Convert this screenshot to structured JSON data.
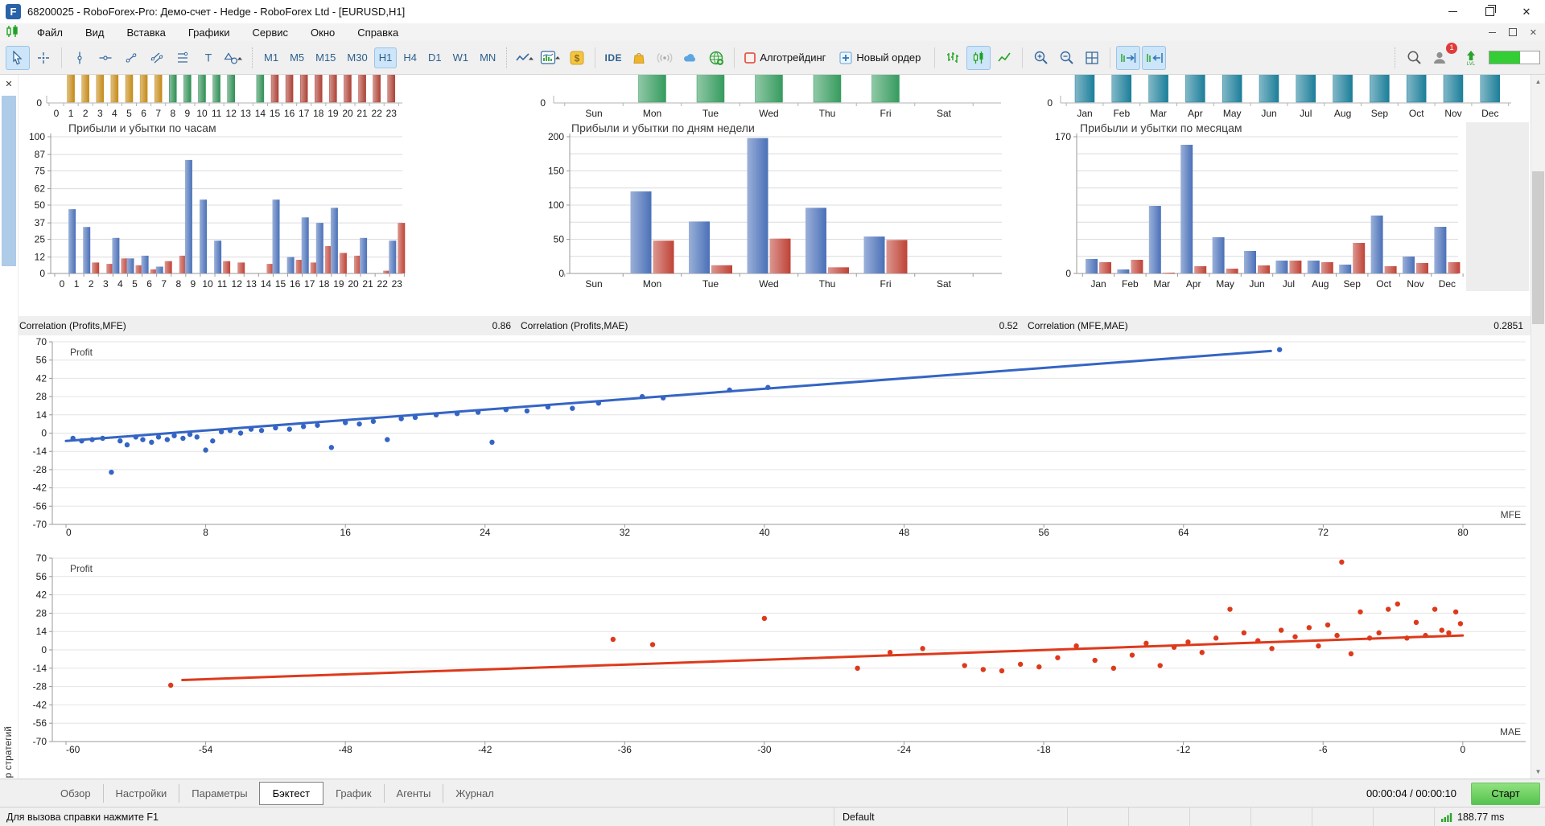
{
  "window": {
    "title": "68200025 - RoboForex-Pro: Демо-счет - Hedge - RoboForex Ltd - [EURUSD,H1]"
  },
  "menu": {
    "items": [
      "Файл",
      "Вид",
      "Вставка",
      "Графики",
      "Сервис",
      "Окно",
      "Справка"
    ]
  },
  "toolbar": {
    "timeframes": [
      "M1",
      "M5",
      "M15",
      "M30",
      "H1",
      "H4",
      "D1",
      "W1",
      "MN"
    ],
    "active_timeframe": "H1",
    "ide_label": "IDE",
    "algo_trading_label": "Алготрейдинг",
    "new_order_label": "Новый ордер",
    "notifications_badge": "1",
    "progress_fill_percent": 62
  },
  "tester": {
    "panel_label": "Тестер стратегий",
    "correlations": [
      {
        "label": "Correlation (Profits,MFE)",
        "value": "0.86"
      },
      {
        "label": "Correlation (Profits,MAE)",
        "value": "0.52"
      },
      {
        "label": "Correlation (MFE,MAE)",
        "value": "0.2851"
      }
    ],
    "tabs": [
      "Обзор",
      "Настройки",
      "Параметры",
      "Бэктест",
      "График",
      "Агенты",
      "Журнал"
    ],
    "active_tab": "Бэктест",
    "elapsed_time": "00:00:04 / 00:00:10",
    "start_button": "Старт"
  },
  "statusbar": {
    "help_text": "Для вызова справки нажмите F1",
    "profile": "Default",
    "ping": "188.77 ms"
  },
  "colors": {
    "profit": "#4a70b8",
    "loss": "#bf4236",
    "mfe": "#3565c4",
    "mae": "#dd3a1c"
  },
  "chart_data": [
    {
      "id": "hours_overview",
      "type": "bar_clipped",
      "note": "top of chart scrolled out of view, only bar bottoms visible",
      "categories": [
        "0",
        "1",
        "2",
        "3",
        "4",
        "5",
        "6",
        "7",
        "8",
        "9",
        "10",
        "11",
        "12",
        "13",
        "14",
        "15",
        "16",
        "17",
        "18",
        "19",
        "20",
        "21",
        "22",
        "23"
      ],
      "bar_colors": [
        null,
        "#c58a17",
        "#c58a17",
        "#c58a17",
        "#c58a17",
        "#c58a17",
        "#c58a17",
        "#c58a17",
        "#2f8f55",
        "#2f8f55",
        "#2f8f55",
        "#2f8f55",
        "#2f8f55",
        null,
        "#2f8f55",
        "#ae4136",
        "#ae4136",
        "#ae4136",
        "#ae4136",
        "#ae4136",
        "#ae4136",
        "#ae4136",
        "#ae4136",
        "#ae4136"
      ],
      "ylabel_zero": "0"
    },
    {
      "id": "days_overview",
      "type": "bar_clipped",
      "categories": [
        "Sun",
        "Mon",
        "Tue",
        "Wed",
        "Thu",
        "Fri",
        "Sat"
      ],
      "bar_colors": [
        null,
        "#359b5e",
        "#359b5e",
        "#359b5e",
        "#359b5e",
        "#359b5e",
        null
      ],
      "ylabel_zero": "0"
    },
    {
      "id": "months_overview",
      "type": "bar_clipped",
      "categories": [
        "Jan",
        "Feb",
        "Mar",
        "Apr",
        "May",
        "Jun",
        "Jul",
        "Aug",
        "Sep",
        "Oct",
        "Nov",
        "Dec"
      ],
      "bar_colors": [
        "#1b7e99",
        "#1b7e99",
        "#1b7e99",
        "#1b7e99",
        "#1b7e99",
        "#1b7e99",
        "#1b7e99",
        "#1b7e99",
        "#1b7e99",
        "#1b7e99",
        "#1b7e99",
        "#1b7e99"
      ],
      "ylabel_zero": "0"
    },
    {
      "id": "hours_pnl",
      "type": "bar",
      "title": "Прибыли и убытки по часам",
      "categories": [
        "0",
        "1",
        "2",
        "3",
        "4",
        "5",
        "6",
        "7",
        "8",
        "9",
        "10",
        "11",
        "12",
        "13",
        "14",
        "15",
        "16",
        "17",
        "18",
        "19",
        "20",
        "21",
        "22",
        "23"
      ],
      "series": [
        {
          "name": "profit",
          "color": "#4a70b8",
          "values": [
            0,
            47,
            34,
            0,
            26,
            11,
            13,
            5,
            0,
            83,
            54,
            24,
            0,
            0,
            0,
            54,
            12,
            41,
            37,
            48,
            0,
            26,
            0,
            24
          ]
        },
        {
          "name": "loss",
          "color": "#bf4236",
          "values": [
            0,
            0,
            8,
            7,
            11,
            6,
            3,
            9,
            13,
            0,
            0,
            9,
            8,
            0,
            7,
            0,
            10,
            8,
            20,
            15,
            13,
            0,
            2,
            37
          ]
        }
      ],
      "ylim": [
        0,
        100
      ],
      "yticks": [
        0,
        12,
        25,
        37,
        50,
        62,
        75,
        87,
        100
      ],
      "ygrid": [
        0,
        12,
        25,
        37,
        50,
        62,
        75,
        87,
        100
      ]
    },
    {
      "id": "days_pnl",
      "type": "bar",
      "title": "Прибыли и убытки по дням недели",
      "categories": [
        "Sun",
        "Mon",
        "Tue",
        "Wed",
        "Thu",
        "Fri",
        "Sat"
      ],
      "series": [
        {
          "name": "profit",
          "color": "#4a70b8",
          "values": [
            0,
            120,
            76,
            198,
            96,
            54,
            0
          ]
        },
        {
          "name": "loss",
          "color": "#bf4236",
          "values": [
            0,
            48,
            12,
            51,
            9,
            49,
            0
          ]
        }
      ],
      "ylim": [
        0,
        200
      ],
      "yticks": [
        0,
        50,
        100,
        150,
        200
      ],
      "ygrid": [
        0,
        25,
        50,
        75,
        100,
        125,
        150,
        175,
        200
      ]
    },
    {
      "id": "months_pnl",
      "type": "bar",
      "title": "Прибыли и убытки по месяцам",
      "categories": [
        "Jan",
        "Feb",
        "Mar",
        "Apr",
        "May",
        "Jun",
        "Jul",
        "Aug",
        "Sep",
        "Oct",
        "Nov",
        "Dec"
      ],
      "series": [
        {
          "name": "profit",
          "color": "#4a70b8",
          "values": [
            18,
            5,
            84,
            160,
            45,
            28,
            16,
            16,
            11,
            72,
            21,
            58
          ]
        },
        {
          "name": "loss",
          "color": "#bf4236",
          "values": [
            14,
            17,
            1,
            9,
            6,
            10,
            16,
            14,
            38,
            9,
            13,
            14
          ]
        }
      ],
      "ylim": [
        0,
        170
      ],
      "yticks": [
        0,
        170
      ],
      "ygrid": [
        0,
        21.25,
        42.5,
        63.75,
        85,
        106.25,
        127.5,
        148.75,
        170
      ]
    },
    {
      "id": "profit_mfe",
      "type": "scatter",
      "corner_label": "Profit",
      "axis_label": "MFE",
      "color": "#3565c4",
      "xlim": [
        0,
        80
      ],
      "ylim": [
        -70,
        70
      ],
      "xticks": [
        0,
        8,
        16,
        24,
        32,
        40,
        48,
        56,
        64,
        72,
        80
      ],
      "yticks": [
        70,
        56,
        42,
        28,
        14,
        0,
        -14,
        -28,
        -42,
        -56,
        -70
      ],
      "trend": [
        [
          0,
          -6
        ],
        [
          69,
          63
        ]
      ],
      "points": [
        [
          0.4,
          -4
        ],
        [
          0.9,
          -6
        ],
        [
          1.5,
          -5
        ],
        [
          2.1,
          -4
        ],
        [
          2.6,
          -30
        ],
        [
          3.1,
          -6
        ],
        [
          3.5,
          -9
        ],
        [
          4,
          -3
        ],
        [
          4.4,
          -5
        ],
        [
          4.9,
          -7
        ],
        [
          5.3,
          -3
        ],
        [
          5.8,
          -5
        ],
        [
          6.2,
          -2
        ],
        [
          6.7,
          -4
        ],
        [
          7.1,
          -1
        ],
        [
          7.5,
          -3
        ],
        [
          8,
          -13
        ],
        [
          8.4,
          -6
        ],
        [
          8.9,
          1
        ],
        [
          9.4,
          2
        ],
        [
          10,
          0
        ],
        [
          10.6,
          3
        ],
        [
          11.2,
          2
        ],
        [
          12,
          4
        ],
        [
          12.8,
          3
        ],
        [
          13.6,
          5
        ],
        [
          14.4,
          6
        ],
        [
          15.2,
          -11
        ],
        [
          16,
          8
        ],
        [
          16.8,
          7
        ],
        [
          17.6,
          9
        ],
        [
          18.4,
          -5
        ],
        [
          19.2,
          11
        ],
        [
          20,
          12
        ],
        [
          21.2,
          14
        ],
        [
          22.4,
          15
        ],
        [
          23.6,
          16
        ],
        [
          24.4,
          -7
        ],
        [
          25.2,
          18
        ],
        [
          26.4,
          17
        ],
        [
          27.6,
          20
        ],
        [
          29,
          19
        ],
        [
          30.5,
          23
        ],
        [
          33,
          28
        ],
        [
          34.2,
          27
        ],
        [
          38,
          33
        ],
        [
          40.2,
          35
        ],
        [
          69.5,
          64
        ]
      ]
    },
    {
      "id": "profit_mae",
      "type": "scatter",
      "corner_label": "Profit",
      "axis_label": "MAE",
      "color": "#dd3a1c",
      "xlim": [
        -60,
        0
      ],
      "ylim": [
        -70,
        70
      ],
      "xticks": [
        -60,
        -54,
        -48,
        -42,
        -36,
        -30,
        -24,
        -18,
        -12,
        -6,
        0
      ],
      "yticks": [
        70,
        56,
        42,
        28,
        14,
        0,
        -14,
        -28,
        -42,
        -56,
        -70
      ],
      "trend": [
        [
          -55,
          -23
        ],
        [
          0,
          11
        ]
      ],
      "points": [
        [
          -55.5,
          -27
        ],
        [
          -36.5,
          8
        ],
        [
          -34.8,
          4
        ],
        [
          -30,
          24
        ],
        [
          -26,
          -14
        ],
        [
          -24.6,
          -2
        ],
        [
          -23.2,
          1
        ],
        [
          -21.4,
          -12
        ],
        [
          -20.6,
          -15
        ],
        [
          -19.8,
          -16
        ],
        [
          -19,
          -11
        ],
        [
          -18.2,
          -13
        ],
        [
          -17.4,
          -6
        ],
        [
          -16.6,
          3
        ],
        [
          -15.8,
          -8
        ],
        [
          -15,
          -14
        ],
        [
          -14.2,
          -4
        ],
        [
          -13.6,
          5
        ],
        [
          -13,
          -12
        ],
        [
          -12.4,
          2
        ],
        [
          -11.8,
          6
        ],
        [
          -11.2,
          -2
        ],
        [
          -10.6,
          9
        ],
        [
          -10,
          31
        ],
        [
          -9.4,
          13
        ],
        [
          -8.8,
          7
        ],
        [
          -8.2,
          1
        ],
        [
          -7.8,
          15
        ],
        [
          -7.2,
          10
        ],
        [
          -6.6,
          17
        ],
        [
          -6.2,
          3
        ],
        [
          -5.8,
          19
        ],
        [
          -5.4,
          11
        ],
        [
          -5.2,
          67
        ],
        [
          -4.8,
          -3
        ],
        [
          -4.4,
          29
        ],
        [
          -4,
          9
        ],
        [
          -3.6,
          13
        ],
        [
          -3.2,
          31
        ],
        [
          -2.8,
          35
        ],
        [
          -2.4,
          9
        ],
        [
          -2,
          21
        ],
        [
          -1.6,
          11
        ],
        [
          -1.2,
          31
        ],
        [
          -0.9,
          15
        ],
        [
          -0.6,
          13
        ],
        [
          -0.3,
          29
        ],
        [
          -0.1,
          20
        ]
      ]
    }
  ]
}
